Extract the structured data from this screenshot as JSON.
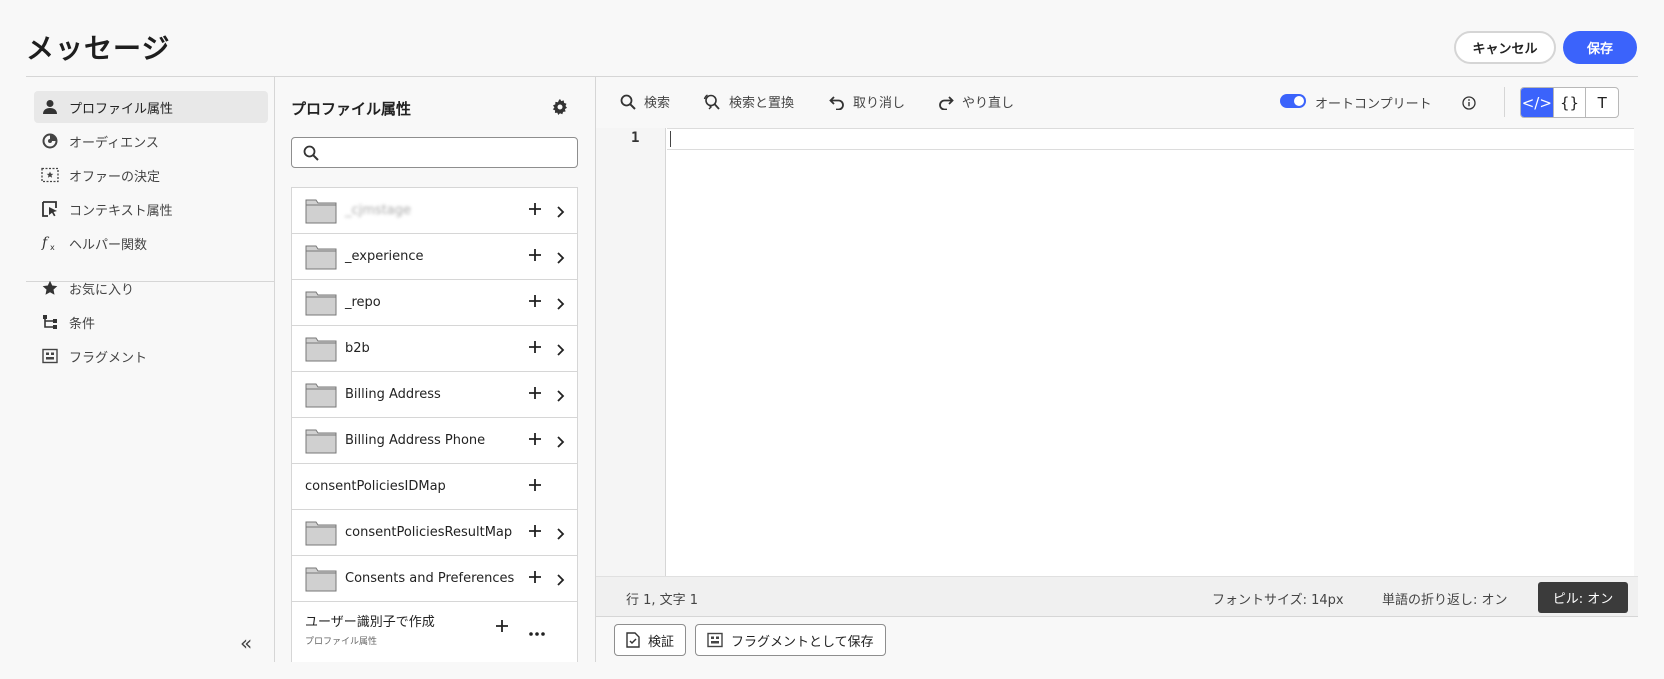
{
  "header": {
    "title": "メッセージ",
    "cancel_label": "キャンセル",
    "save_label": "保存"
  },
  "nav": {
    "items": [
      {
        "label": "プロファイル属性",
        "icon": "user-icon",
        "active": true
      },
      {
        "label": "オーディエンス",
        "icon": "audience-icon"
      },
      {
        "label": "オファーの決定",
        "icon": "offer-icon"
      },
      {
        "label": "コンテキスト属性",
        "icon": "context-icon"
      },
      {
        "label": "ヘルパー関数",
        "icon": "function-icon"
      },
      {
        "label": "お気に入り",
        "icon": "star-icon"
      },
      {
        "label": "条件",
        "icon": "condition-icon"
      },
      {
        "label": "フラグメント",
        "icon": "fragment-icon"
      }
    ],
    "collapse_glyph": "«"
  },
  "panel": {
    "title": "プロファイル属性",
    "search_placeholder": "",
    "rows": [
      {
        "label": "_cjmstage",
        "folder": true,
        "chevron": true
      },
      {
        "label": "_experience",
        "folder": true,
        "chevron": true
      },
      {
        "label": "_repo",
        "folder": true,
        "chevron": true
      },
      {
        "label": "b2b",
        "folder": true,
        "chevron": true
      },
      {
        "label": "Billing Address",
        "folder": true,
        "chevron": true
      },
      {
        "label": "Billing Address Phone",
        "folder": true,
        "chevron": true
      },
      {
        "label": "consentPoliciesIDMap",
        "folder": false,
        "chevron": false
      },
      {
        "label": "consentPoliciesResultMap",
        "folder": true,
        "chevron": true
      },
      {
        "label": "Consents and Preferences",
        "folder": true,
        "chevron": true
      }
    ],
    "last_row": {
      "label": "ユーザー識別子で作成",
      "sub": "プロファイル属性"
    }
  },
  "toolbar": {
    "search": "検索",
    "find_replace": "検索と置換",
    "undo": "取り消し",
    "redo": "やり直し",
    "autocomplete": "オートコンプリート",
    "autocomplete_on": true,
    "modes": [
      "</>",
      "{}",
      "T"
    ]
  },
  "editor": {
    "line_numbers": [
      "1"
    ],
    "content": ""
  },
  "status": {
    "position": "行 1, 文字 1",
    "font_size": "フォントサイズ: 14px",
    "word_wrap": "単語の折り返し: オン",
    "pill": "ピル: オン"
  },
  "bottom": {
    "validate": "検証",
    "save_fragment": "フラグメントとして保存"
  },
  "colors": {
    "accent": "#3b63fb",
    "pill_bg": "#3b3b3b"
  }
}
